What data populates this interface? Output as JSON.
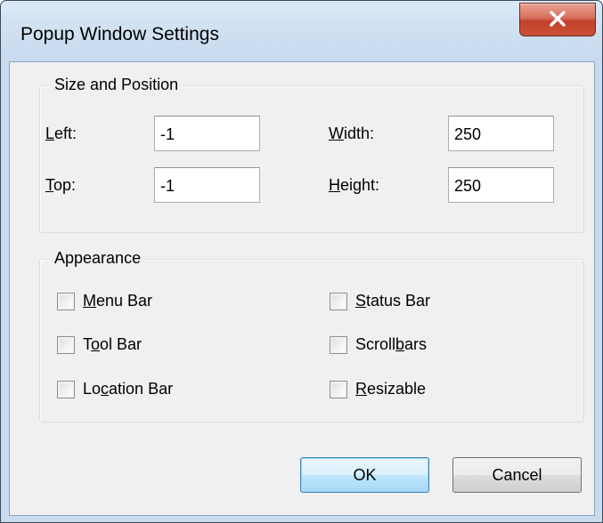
{
  "window": {
    "title": "Popup Window Settings",
    "close_icon": "close-x-icon"
  },
  "size_position": {
    "group_label": "Size and Position",
    "left": {
      "prefix": "",
      "accel": "L",
      "suffix": "eft:",
      "value": "-1"
    },
    "top": {
      "prefix": "",
      "accel": "T",
      "suffix": "op:",
      "value": "-1"
    },
    "width": {
      "prefix": "",
      "accel": "W",
      "suffix": "idth:",
      "value": "250"
    },
    "height": {
      "prefix": "",
      "accel": "H",
      "suffix": "eight:",
      "value": "250"
    }
  },
  "appearance": {
    "group_label": "Appearance",
    "options": [
      {
        "prefix": "",
        "accel": "M",
        "suffix": "enu Bar",
        "checked": false
      },
      {
        "prefix": "",
        "accel": "S",
        "suffix": "tatus Bar",
        "checked": false
      },
      {
        "prefix": "T",
        "accel": "o",
        "suffix": "ol Bar",
        "checked": false
      },
      {
        "prefix": "Scroll",
        "accel": "b",
        "suffix": "ars",
        "checked": false
      },
      {
        "prefix": "Lo",
        "accel": "c",
        "suffix": "ation Bar",
        "checked": false
      },
      {
        "prefix": "",
        "accel": "R",
        "suffix": "esizable",
        "checked": false
      }
    ]
  },
  "buttons": {
    "ok": "OK",
    "cancel": "Cancel"
  }
}
